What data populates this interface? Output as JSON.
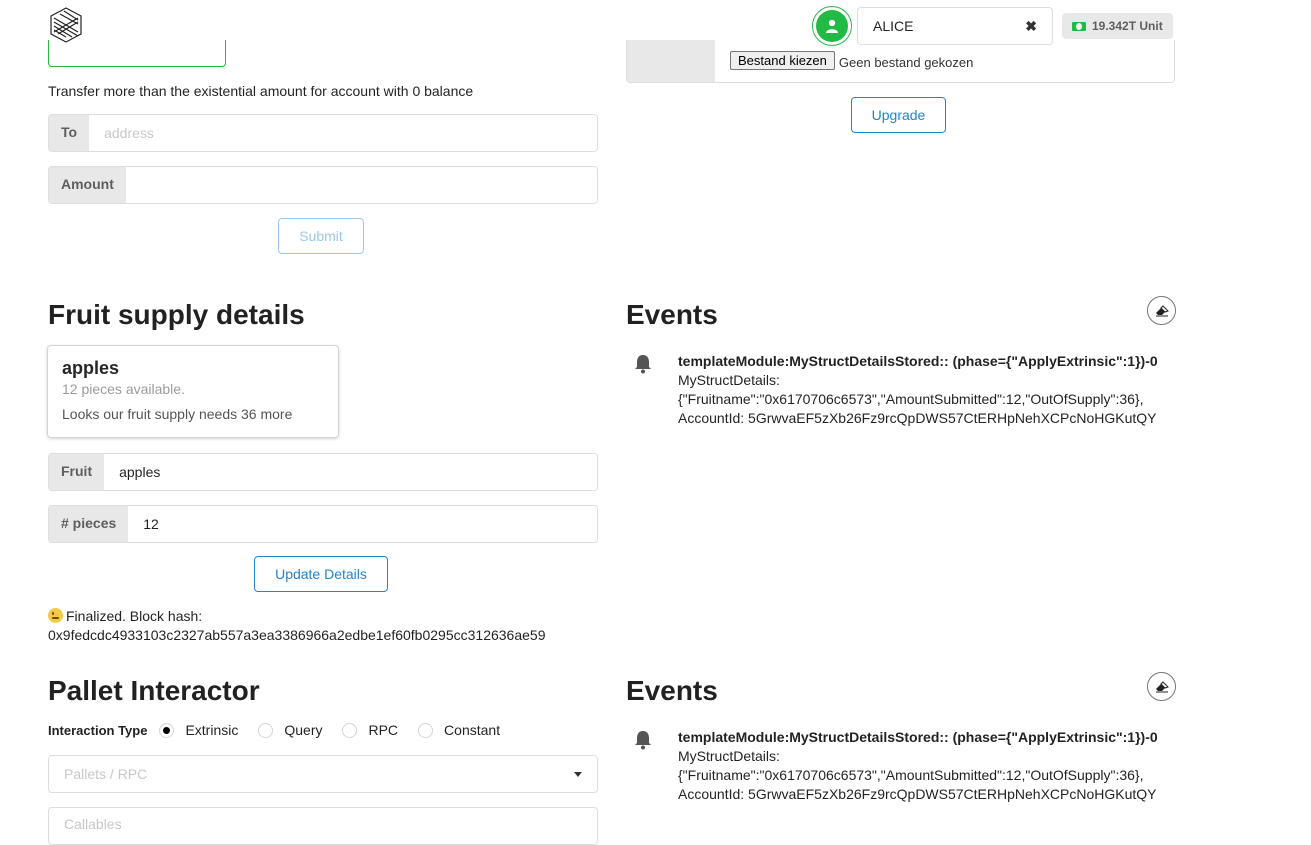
{
  "header": {
    "logo_icon": "substrate-logo-icon",
    "account": {
      "name": "ALICE",
      "clear_glyph": "✖"
    },
    "balance": "19.342T Unit",
    "balance_icon": "money-icon",
    "avatar_icon": "user-icon"
  },
  "transfer": {
    "note": "Transfer more than the existential amount for account with 0 balance",
    "to_label": "To",
    "to_placeholder": "address",
    "amount_label": "Amount",
    "amount_value": "",
    "submit_label": "Submit"
  },
  "upgrade": {
    "file_button": "Bestand kiezen",
    "file_status": "Geen bestand gekozen",
    "upgrade_label": "Upgrade"
  },
  "fruit": {
    "title": "Fruit supply details",
    "card": {
      "name": "apples",
      "meta": "12 pieces available.",
      "description": "Looks our fruit supply needs 36 more"
    },
    "fruit_label": "Fruit",
    "fruit_value": "apples",
    "pieces_label": "# pieces",
    "pieces_value": "12",
    "update_label": "Update Details",
    "status_text": "Finalized. Block hash:",
    "block_hash": "0x9fedcdc4933103c2327ab557a3ea3386966a2edbe1ef60fb0295cc312636ae59"
  },
  "events_top": {
    "title": "Events",
    "items": [
      {
        "summary": "templateModule:MyStructDetailsStored:: (phase={\"ApplyExtrinsic\":1})-0",
        "line1": "MyStructDetails:",
        "line2": "{\"Fruitname\":\"0x6170706c6573\",\"AmountSubmitted\":12,\"OutOfSupply\":36},",
        "line3": "AccountId: 5GrwvaEF5zXb26Fz9rcQpDWS57CtERHpNehXCPcNoHGKutQY"
      }
    ]
  },
  "pallet": {
    "title": "Pallet Interactor",
    "interaction_label": "Interaction Type",
    "options": [
      "Extrinsic",
      "Query",
      "RPC",
      "Constant"
    ],
    "selected": "Extrinsic",
    "pallets_placeholder": "Pallets / RPC",
    "callables_placeholder": "Callables"
  },
  "events_bottom": {
    "title": "Events",
    "items": [
      {
        "summary": "templateModule:MyStructDetailsStored:: (phase={\"ApplyExtrinsic\":1})-0",
        "line1": "MyStructDetails:",
        "line2": "{\"Fruitname\":\"0x6170706c6573\",\"AmountSubmitted\":12,\"OutOfSupply\":36},",
        "line3": "AccountId: 5GrwvaEF5zXb26Fz9rcQpDWS57CtERHpNehXCPcNoHGKutQY"
      }
    ]
  },
  "colors": {
    "primary": "#2185d0",
    "success": "#21ba45",
    "label_bg": "#e8e8e8"
  }
}
